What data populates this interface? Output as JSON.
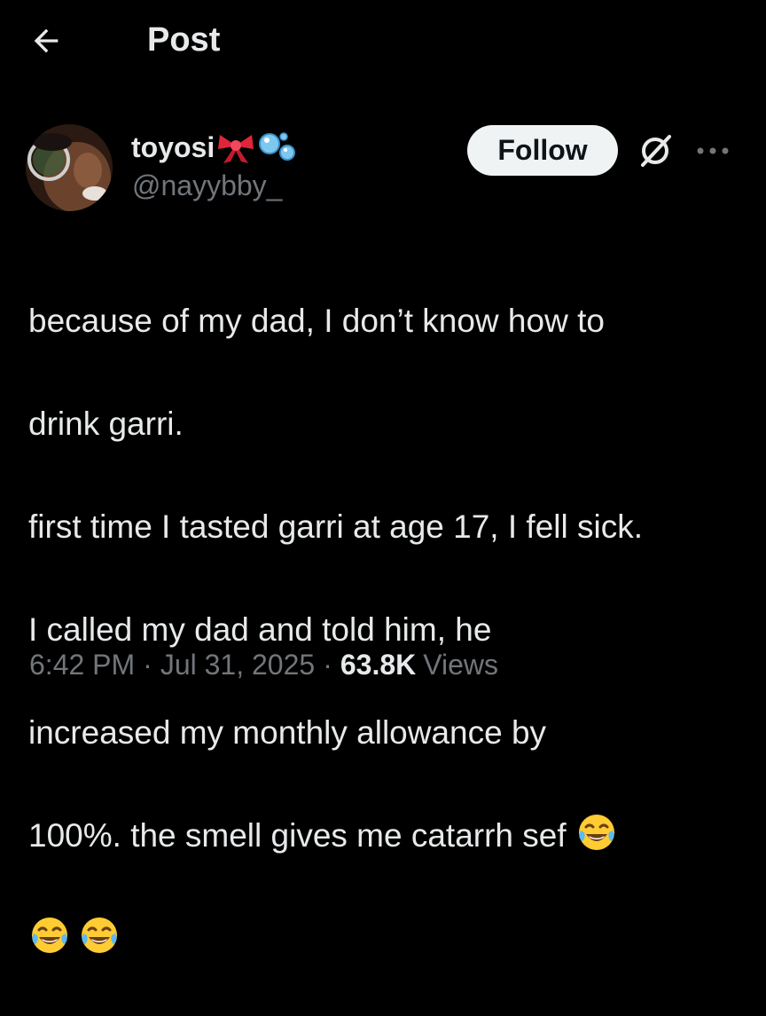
{
  "header": {
    "title": "Post",
    "back_icon": "arrow-left-icon"
  },
  "author": {
    "display_name": "toyosi",
    "handle": "@nayybby_",
    "name_emojis": [
      "ribbon-emoji",
      "bubbles-emoji"
    ],
    "avatar": "avatar"
  },
  "actions": {
    "follow_label": "Follow",
    "grok_icon": "grok-icon",
    "more_icon": "more-dots-icon"
  },
  "post": {
    "lines": [
      "because of my dad, I don’t know how to",
      "drink garri.",
      "first time I tasted garri at age 17, I fell sick.",
      "I called my dad and told him, he",
      "increased my monthly allowance by",
      "100%. the smell gives me catarrh sef"
    ],
    "trailing_emoji": "tears-of-joy-emoji",
    "trailing_emoji_count": 3
  },
  "meta": {
    "time": "6:42 PM",
    "separator": "·",
    "date": "Jul 31, 2025",
    "views_count": "63.8K",
    "views_label": "Views"
  },
  "colors": {
    "background": "#000000",
    "text": "#e7e9ea",
    "secondary_text": "#71767b",
    "follow_bg": "#eff3f4"
  }
}
